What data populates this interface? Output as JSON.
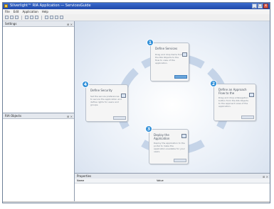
{
  "window": {
    "title": "Silverlight™ RIA Application — ServicesGuide",
    "buttons": [
      "_",
      "□",
      "×"
    ]
  },
  "menu": [
    "File",
    "Edit",
    "Application",
    "Help"
  ],
  "toolbar": {
    "icons": [
      "new-icon",
      "open-icon",
      "save-icon",
      "cut-icon",
      "copy-icon",
      "paste-icon",
      "undo-icon",
      "redo-icon",
      "run-icon",
      "help-icon"
    ]
  },
  "left": {
    "top_pane_title": "Settings",
    "bottom_pane_title": "RIA Objects",
    "pin": "⊞ ×"
  },
  "steps": [
    {
      "num": "1",
      "title": "Define Services",
      "desc": "Drag and drop items from the RIA Objects to the flow to view of the application.",
      "icon": "server-icon"
    },
    {
      "num": "2",
      "title": "Define an Approach",
      "title2": "Flow to the",
      "desc": "Drag and drop a Navigation button from the RIA Objects to the approach area of the application.",
      "icon": "flow-icon"
    },
    {
      "num": "3",
      "title": "Deploy the",
      "title2": "Application",
      "desc": "Deploy the application to the portal to make the application available for your users.",
      "icon": "deploy-icon"
    },
    {
      "num": "4",
      "title": "Define Security",
      "desc": "Set the secure preferences to secure the application and define rights for users and groups.",
      "icon": "security-icon"
    }
  ],
  "bottom": {
    "title": "Properties",
    "columns": [
      "Name",
      "Value"
    ]
  },
  "colors": {
    "accent": "#2f8fd8",
    "title_bar": "#1f48a8"
  }
}
